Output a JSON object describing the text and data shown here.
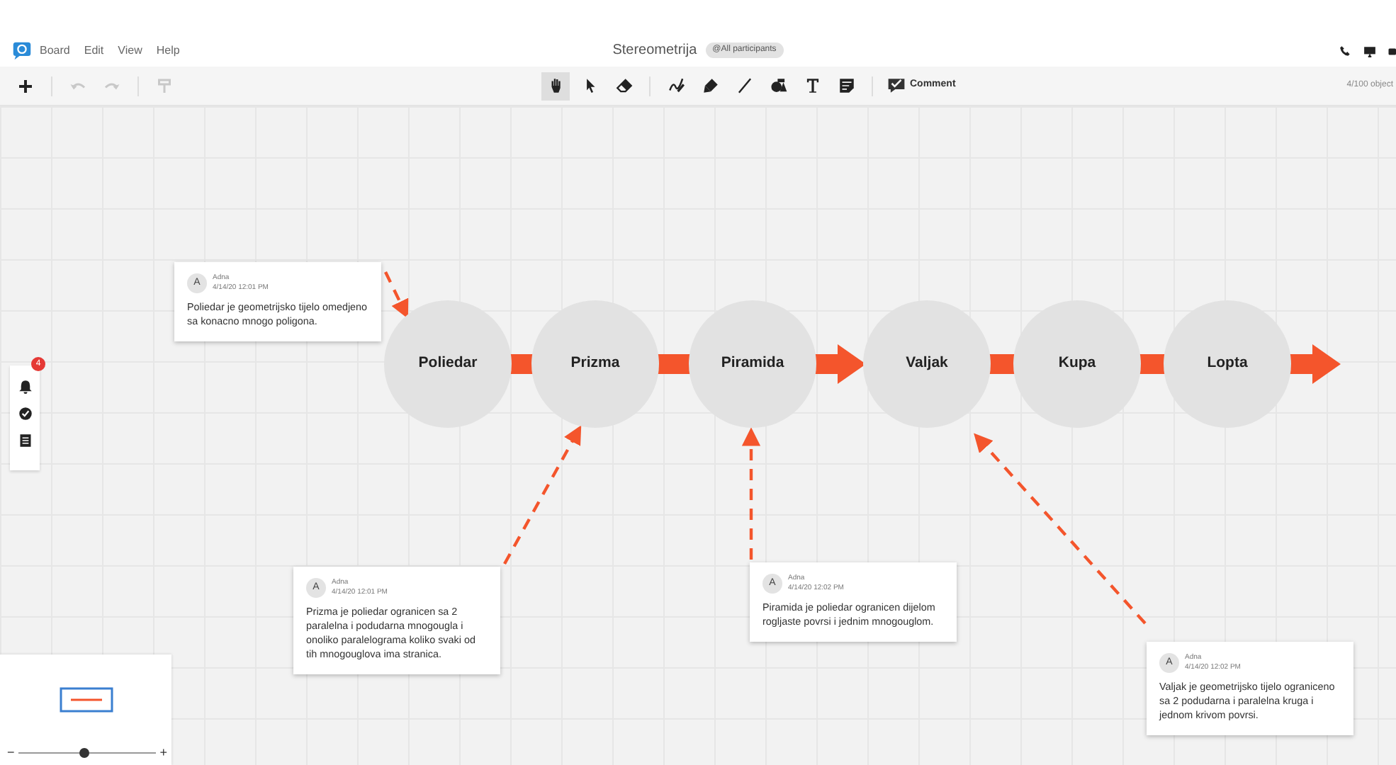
{
  "menu": {
    "items": [
      "Board",
      "Edit",
      "View",
      "Help"
    ]
  },
  "board": {
    "title": "Stereometrija",
    "audience": "@All participants",
    "objects": "4/100 object"
  },
  "left_tools": [
    {
      "kind": "add",
      "disabled": false
    },
    {
      "kind": "undo",
      "disabled": true
    },
    {
      "kind": "redo",
      "disabled": true
    },
    {
      "kind": "format",
      "disabled": true
    }
  ],
  "tools": [
    {
      "kind": "hand",
      "selected": true
    },
    {
      "kind": "pointer",
      "selected": false
    },
    {
      "kind": "eraser",
      "selected": false
    },
    {
      "kind": "pen",
      "selected": false
    },
    {
      "kind": "marker",
      "selected": false
    },
    {
      "kind": "line",
      "selected": false
    },
    {
      "kind": "shapes",
      "selected": false
    },
    {
      "kind": "text",
      "selected": false
    },
    {
      "kind": "note",
      "selected": false
    }
  ],
  "comment_button": {
    "label": "Comment"
  },
  "side_panel": {
    "badge": "4"
  },
  "flow": [
    {
      "label": "Poliedar",
      "arrowhead": false
    },
    {
      "label": "Prizma",
      "arrowhead": false
    },
    {
      "label": "Piramida",
      "arrowhead": true
    },
    {
      "label": "Valjak",
      "arrowhead": false
    },
    {
      "label": "Kupa",
      "arrowhead": false
    },
    {
      "label": "Lopta",
      "arrowhead": true
    }
  ],
  "notes": [
    {
      "avatar": "A",
      "author": "Adna",
      "time": "4/14/20 12:01 PM",
      "text": "Poliedar je geometrijsko tijelo omedjeno sa konacno mnogo poligona."
    },
    {
      "avatar": "A",
      "author": "Adna",
      "time": "4/14/20 12:01 PM",
      "text": "Prizma je poliedar ogranicen sa 2 paralelna i podudarna mnogougla i onoliko paralelograma koliko svaki od tih mnogouglova ima stranica."
    },
    {
      "avatar": "A",
      "author": "Adna",
      "time": "4/14/20 12:02 PM",
      "text": "Piramida je poliedar ogranicen dijelom rogljaste povrsi i jednim mnogouglom."
    },
    {
      "avatar": "A",
      "author": "Adna",
      "time": "4/14/20 12:02 PM",
      "text": "Valjak je geometrijsko tijelo ograniceno sa 2 podudarna i paralelna kruga i jednom krivom povrsi."
    }
  ],
  "zoom": {
    "out_label": "−",
    "in_label": "+",
    "level": 0.47
  }
}
